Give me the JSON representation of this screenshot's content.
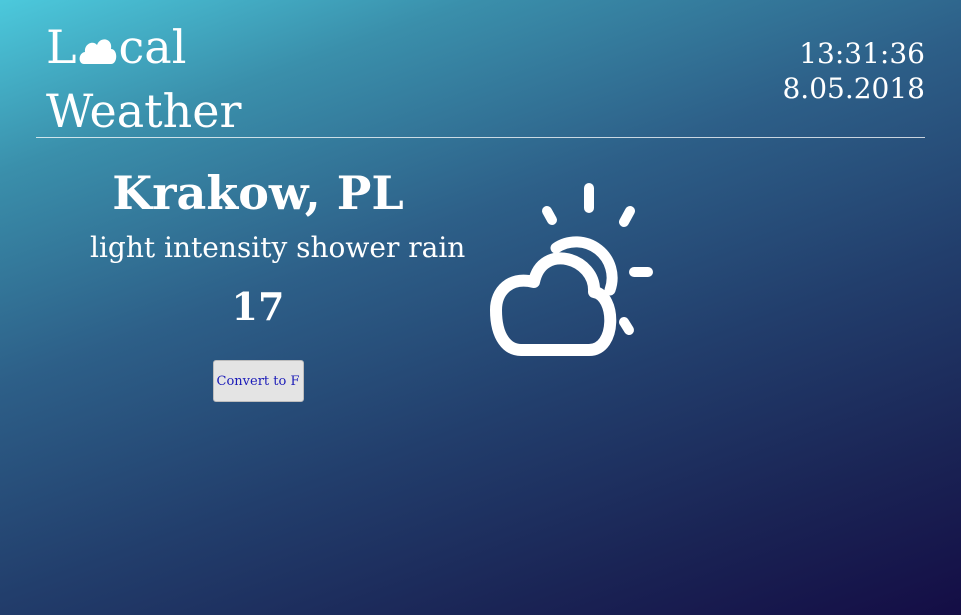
{
  "logo": {
    "line1_prefix": "L",
    "line1_icon": "cloud-icon",
    "line1_suffix": "cal",
    "line2": "Weather"
  },
  "clock": {
    "time": "13:31:36",
    "date": "8.05.2018"
  },
  "weather": {
    "location": "Krakow, PL",
    "description": "light intensity shower rain",
    "temperature": "17",
    "icon": "partly-cloudy-icon"
  },
  "convert_button": {
    "label": "Convert to F"
  },
  "colors": {
    "gradient_start": "#4cc9dc",
    "gradient_end": "#140d45",
    "text": "#ffffff",
    "button_bg": "#e4e4e4",
    "button_text": "#1b1bb8"
  }
}
